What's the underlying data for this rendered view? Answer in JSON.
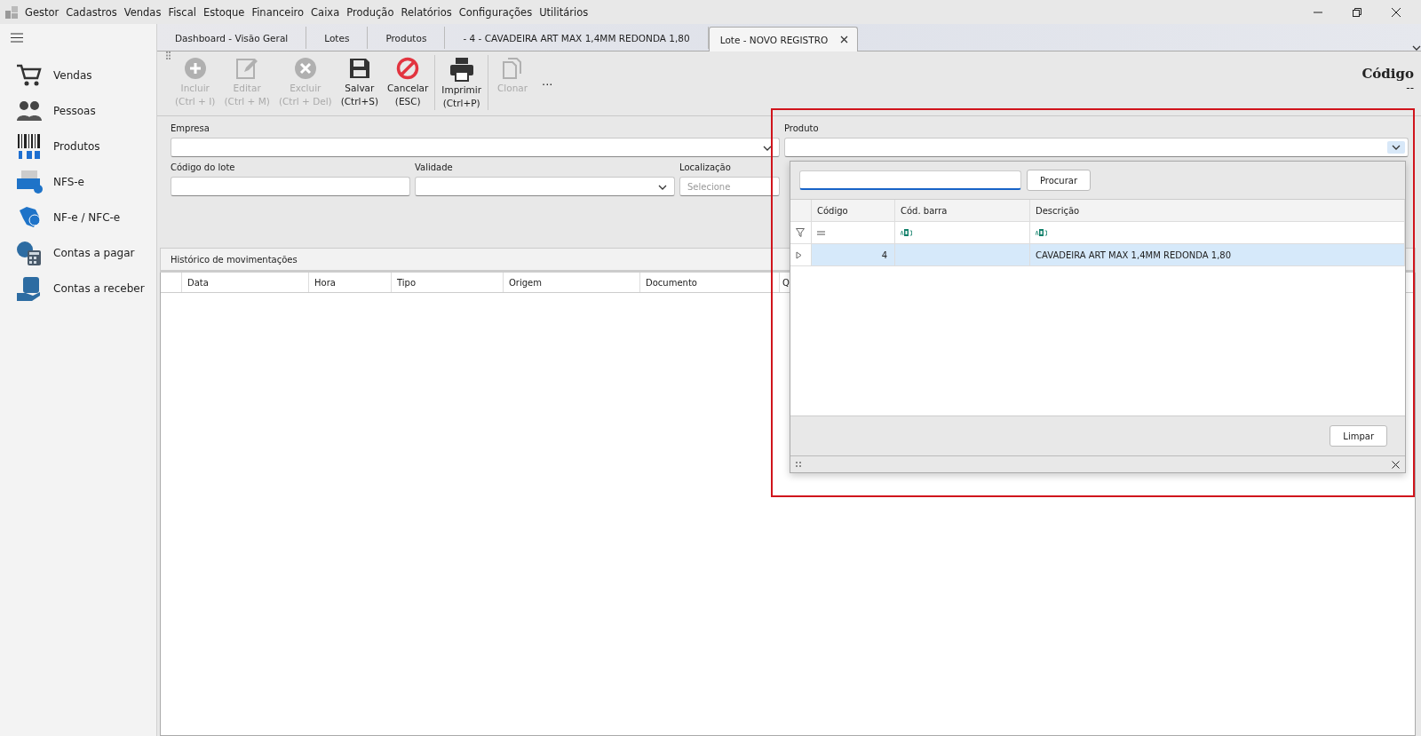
{
  "menu": {
    "app_name": "Gestor",
    "items": [
      "Cadastros",
      "Vendas",
      "Fiscal",
      "Estoque",
      "Financeiro",
      "Caixa",
      "Produção",
      "Relatórios",
      "Configurações",
      "Utilitários"
    ]
  },
  "sidebar": {
    "items": [
      {
        "label": "Vendas",
        "kind": "cart"
      },
      {
        "label": "Pessoas",
        "kind": "people"
      },
      {
        "label": "Produtos",
        "kind": "barcode"
      },
      {
        "label": "NFS-e",
        "kind": "nfse"
      },
      {
        "label": "NF-e / NFC-e",
        "kind": "nfe"
      },
      {
        "label": "Contas a pagar",
        "kind": "pay"
      },
      {
        "label": "Contas a receber",
        "kind": "receive"
      }
    ]
  },
  "tabs": [
    {
      "label": "Dashboard - Visão Geral",
      "selected": false
    },
    {
      "label": "Lotes",
      "selected": false
    },
    {
      "label": "Produtos",
      "selected": false
    },
    {
      "label": "- 4 - CAVADEIRA ART MAX 1,4MM REDONDA 1,80",
      "selected": false
    },
    {
      "label": "Lote - NOVO REGISTRO",
      "selected": true
    }
  ],
  "toolbar": {
    "buttons": [
      {
        "label": "Incluir",
        "shortcut": "(Ctrl + I)",
        "kind": "add",
        "disabled": true
      },
      {
        "label": "Editar",
        "shortcut": "(Ctrl + M)",
        "kind": "edit",
        "disabled": true
      },
      {
        "label": "Excluir",
        "shortcut": "(Ctrl + Del)",
        "kind": "delete",
        "disabled": true
      },
      {
        "label": "Salvar",
        "shortcut": "(Ctrl+S)",
        "kind": "save",
        "disabled": false
      },
      {
        "label": "Cancelar",
        "shortcut": "(ESC)",
        "kind": "cancel",
        "disabled": false
      },
      {
        "label": "Imprimir",
        "shortcut": "(Ctrl+P)",
        "kind": "print",
        "disabled": false
      },
      {
        "label": "Clonar",
        "kind": "clone",
        "disabled": true
      }
    ],
    "more": "..."
  },
  "record": {
    "label": "Código",
    "value": "--"
  },
  "form": {
    "fields": [
      {
        "label": "Empresa",
        "kind": "dropdown"
      },
      {
        "label": "Produto",
        "kind": "dropdown"
      },
      {
        "label": "Código do lote",
        "kind": "text"
      },
      {
        "label": "Validade",
        "kind": "dropdown"
      },
      {
        "label": "Localização",
        "kind": "text",
        "placeholder": "Selecione"
      }
    ]
  },
  "history": {
    "tab": "Histórico de movimentações",
    "columns": [
      "Data",
      "Hora",
      "Tipo",
      "Origem",
      "Documento",
      "Q"
    ]
  },
  "product_popup": {
    "search_button": "Procurar",
    "columns": [
      "Código",
      "Cód. barra",
      "Descrição"
    ],
    "filters": [
      {
        "kind": "equals"
      },
      {
        "kind": "text"
      },
      {
        "kind": "text"
      }
    ],
    "rows": [
      {
        "code": "4",
        "description": "CAVADEIRA ART MAX 1,4MM REDONDA 1,80",
        "selected": true
      }
    ],
    "clear_button": "Limpar"
  }
}
